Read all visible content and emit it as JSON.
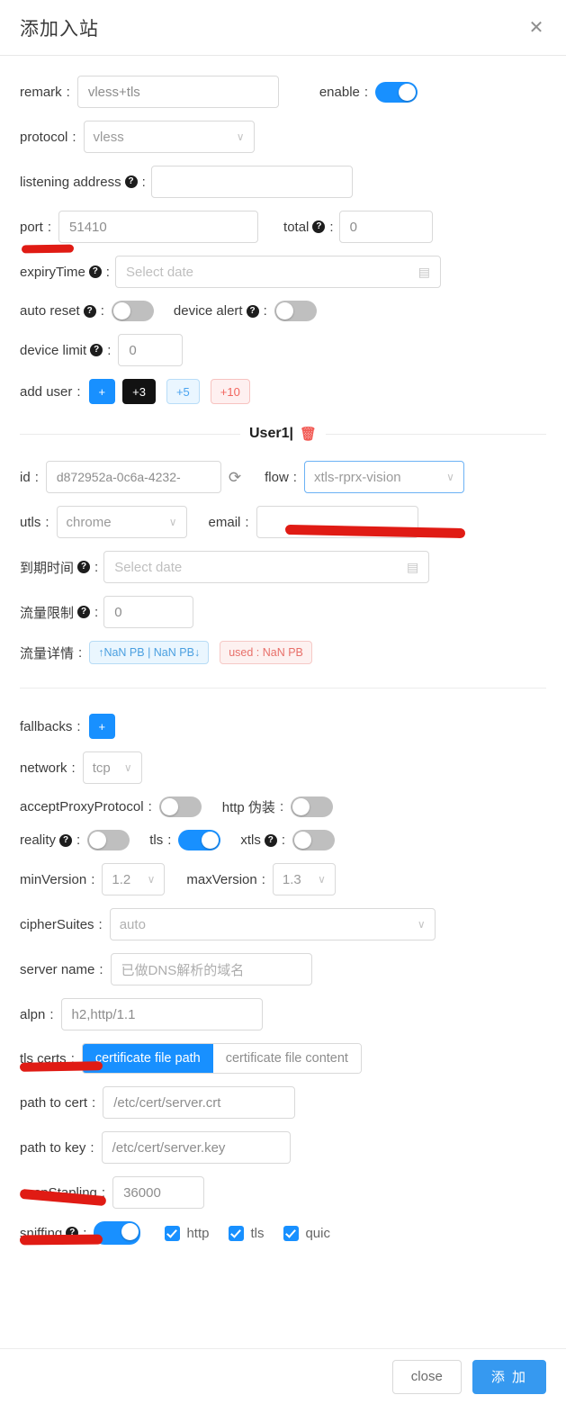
{
  "dialog": {
    "title": "添加入站",
    "close_icon": "close-icon"
  },
  "form": {
    "remark": {
      "label": "remark",
      "value": "vless+tls"
    },
    "enable": {
      "label": "enable",
      "state": "on"
    },
    "protocol": {
      "label": "protocol",
      "value": "vless"
    },
    "listening_address": {
      "label": "listening address",
      "value": ""
    },
    "port": {
      "label": "port",
      "value": "51410"
    },
    "total": {
      "label": "total",
      "value": "0"
    },
    "expiry_time": {
      "label": "expiryTime",
      "placeholder": "Select date"
    },
    "auto_reset": {
      "label": "auto reset",
      "state": "off"
    },
    "device_alert": {
      "label": "device alert",
      "state": "off"
    },
    "device_limit": {
      "label": "device limit",
      "value": "0"
    },
    "add_user": {
      "label": "add user",
      "buttons": [
        {
          "text": "+",
          "style": "primary"
        },
        {
          "text": "+3",
          "style": "dark"
        },
        {
          "text": "+5",
          "style": "light-blue"
        },
        {
          "text": "+10",
          "style": "light-red"
        }
      ]
    }
  },
  "user_section": {
    "divider_label": "User1|",
    "delete_icon": "trash-icon",
    "id": {
      "label": "id",
      "value": "d872952a-0c6a-4232-"
    },
    "refresh_icon": "refresh-icon",
    "flow": {
      "label": "flow",
      "value": "xtls-rprx-vision"
    },
    "utls": {
      "label": "utls",
      "value": "chrome"
    },
    "email": {
      "label": "email",
      "value": ""
    },
    "expiry_cn": {
      "label": "到期时间",
      "placeholder": "Select date"
    },
    "traffic_limit_cn": {
      "label": "流量限制",
      "value": "0"
    },
    "traffic_detail_cn": {
      "label": "流量详情",
      "up_down_tag": "↑NaN PB | NaN PB↓",
      "used_tag": "used : NaN PB"
    }
  },
  "transport": {
    "fallbacks": {
      "label": "fallbacks",
      "add_text": "+"
    },
    "network": {
      "label": "network",
      "value": "tcp"
    },
    "accept_proxy_protocol": {
      "label": "acceptProxyProtocol",
      "state": "off"
    },
    "http_disguise": {
      "label": "http 伪装",
      "state": "off"
    },
    "reality": {
      "label": "reality",
      "state": "off"
    },
    "tls": {
      "label": "tls",
      "state": "on"
    },
    "xtls": {
      "label": "xtls",
      "state": "off"
    },
    "min_version": {
      "label": "minVersion",
      "value": "1.2"
    },
    "max_version": {
      "label": "maxVersion",
      "value": "1.3"
    },
    "cipher_suites": {
      "label": "cipherSuites",
      "value": "auto"
    },
    "server_name": {
      "label": "server name",
      "placeholder": "已做DNS解析的域名"
    },
    "alpn": {
      "label": "alpn",
      "value": "h2,http/1.1"
    },
    "tls_certs": {
      "label": "tls certs",
      "options": [
        "certificate file path",
        "certificate file content"
      ],
      "selected": "certificate file path"
    },
    "path_to_cert": {
      "label": "path to cert",
      "value": "/etc/cert/server.crt"
    },
    "path_to_key": {
      "label": "path to key",
      "value": "/etc/cert/server.key"
    },
    "ocsp_stapling": {
      "label": "ocspStapling",
      "value": "36000"
    },
    "sniffing": {
      "label": "sniffing",
      "state": "on",
      "options": [
        {
          "label": "http",
          "checked": true
        },
        {
          "label": "tls",
          "checked": true
        },
        {
          "label": "quic",
          "checked": true
        }
      ]
    }
  },
  "footer": {
    "close_label": "close",
    "submit_label": "添 加"
  },
  "colors": {
    "accent": "#1890ff",
    "submit": "#3699f0",
    "danger": "#e8706a",
    "annotation": "#e01b14"
  }
}
